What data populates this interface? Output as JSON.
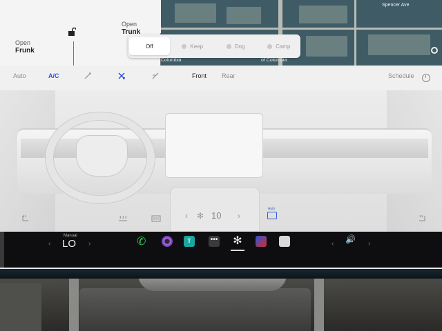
{
  "vehicle": {
    "frunk": {
      "line1": "Open",
      "line2": "Frunk"
    },
    "trunk": {
      "line1": "Open",
      "line2": "Trunk"
    }
  },
  "map": {
    "labels": [
      "Spencer Ave",
      "Columbia",
      "of Columbia"
    ]
  },
  "climate_keeper": {
    "modes": [
      {
        "label": "Off",
        "active": true
      },
      {
        "label": "Keep",
        "active": false
      },
      {
        "label": "Dog",
        "active": false
      },
      {
        "label": "Camp",
        "active": false
      }
    ]
  },
  "climate": {
    "auto_label": "Auto",
    "ac_label": "A/C",
    "front_label": "Front",
    "rear_label": "Rear",
    "schedule_label": "Schedule",
    "accent": "#2d4fd8"
  },
  "interior": {
    "fan_speed": "10",
    "auto_small": "Auto"
  },
  "dock": {
    "temp_mode": "Manual",
    "temp_value": "LO",
    "left_arrow": "‹",
    "right_arrow": "›",
    "tesla_app_badge": "T",
    "more_glyph": "•••",
    "volume_glyph": "🔊",
    "icons": [
      "phone-icon",
      "camera-icon",
      "tesla-app-icon",
      "more-icon",
      "fan-icon",
      "navigation-icon",
      "card-icon"
    ]
  }
}
